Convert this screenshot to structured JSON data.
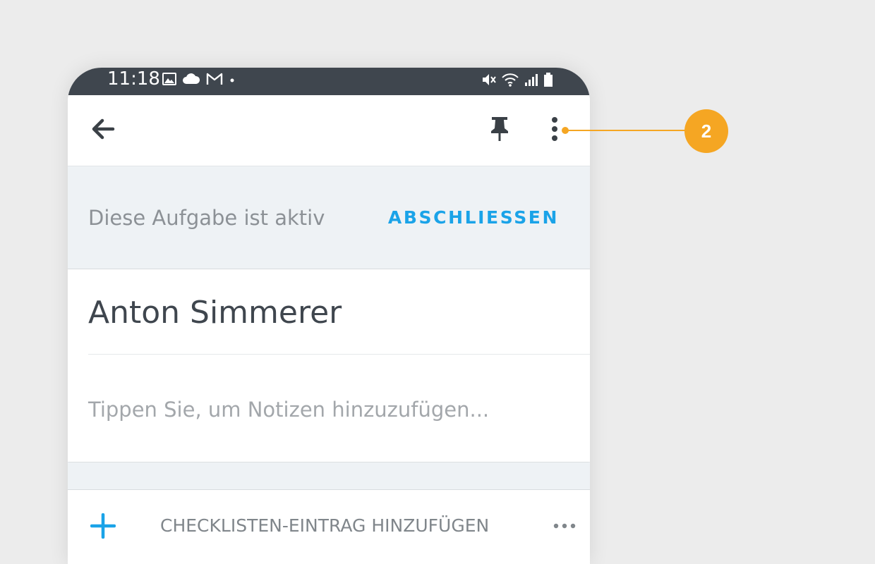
{
  "statusbar": {
    "time": "11:18",
    "left_icons": [
      "image-icon",
      "cloud-icon",
      "gmail-icon",
      "dot-icon"
    ],
    "right_icons": [
      "mute-icon",
      "wifi-icon",
      "signal-icon",
      "battery-icon"
    ]
  },
  "appbar": {
    "back_icon": "arrow-left-icon",
    "pin_icon": "pin-icon",
    "menu_icon": "more-vertical-icon"
  },
  "task_status": {
    "text": "Diese Aufgabe ist aktiv",
    "action_label": "ABSCHLIESSEN",
    "action_color": "#1aa3e8"
  },
  "task": {
    "title": "Anton Simmerer",
    "notes_placeholder": "Tippen Sie, um Notizen hinzuzufügen..."
  },
  "checklist": {
    "add_icon": "plus-icon",
    "add_label": "CHECKLISTEN-EINTRAG HINZUFÜGEN",
    "more_icon": "more-horizontal-icon"
  },
  "callout": {
    "number": "2",
    "color": "#f5a623"
  }
}
